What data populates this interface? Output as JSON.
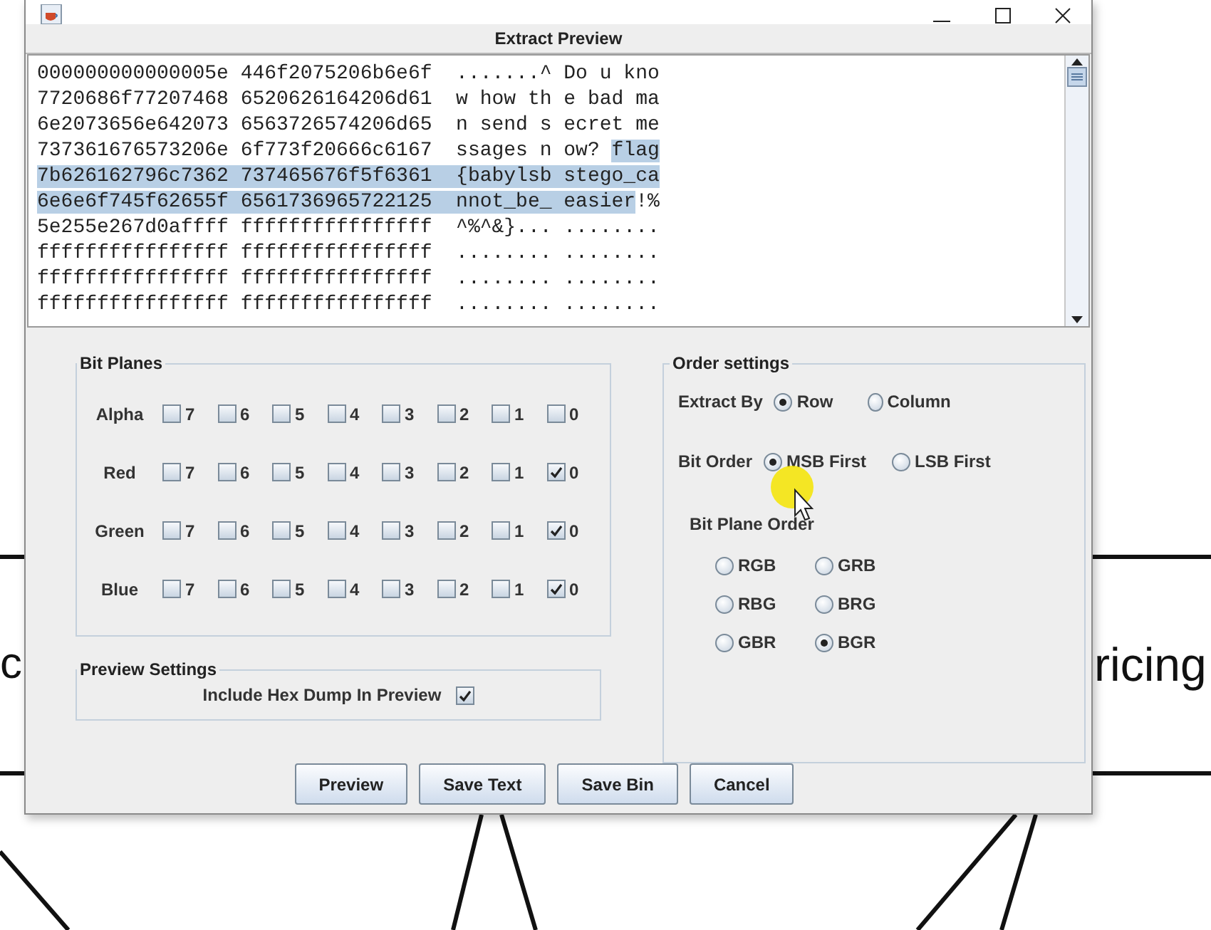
{
  "background": {
    "labels": [
      "c",
      "ricing"
    ]
  },
  "header": {
    "title": "Extract Preview"
  },
  "preview": {
    "lines": [
      {
        "segments": [
          {
            "text": "000000000000005e 446f2075206b6e6f  .......^ Do u kno",
            "selected": false
          }
        ]
      },
      {
        "segments": [
          {
            "text": "7720686f77207468 6520626164206d61  w how th e bad ma",
            "selected": false
          }
        ]
      },
      {
        "segments": [
          {
            "text": "6e2073656e642073 6563726574206d65  n send s ecret me",
            "selected": false
          }
        ]
      },
      {
        "segments": [
          {
            "text": "737361676573206e 6f773f20666c6167  ssages n ow? ",
            "selected": false
          },
          {
            "text": "flag",
            "selected": true
          }
        ]
      },
      {
        "segments": [
          {
            "text": "7b626162796c7362 737465676f5f6361  {babylsb stego_ca",
            "selected": true
          }
        ]
      },
      {
        "segments": [
          {
            "text": "6e6e6f745f62655f 6561736965722125  nnot_be_ easier",
            "selected": true
          },
          {
            "text": "!%",
            "selected": false
          }
        ]
      },
      {
        "segments": [
          {
            "text": "5e255e267d0affff ffffffffffffffff  ^%^&}... ........",
            "selected": false
          }
        ]
      },
      {
        "segments": [
          {
            "text": "ffffffffffffffff ffffffffffffffff  ........ ........",
            "selected": false
          }
        ]
      },
      {
        "segments": [
          {
            "text": "ffffffffffffffff ffffffffffffffff  ........ ........",
            "selected": false
          }
        ]
      },
      {
        "segments": [
          {
            "text": "ffffffffffffffff ffffffffffffffff  ........ ........",
            "selected": false
          }
        ]
      }
    ]
  },
  "bit_planes": {
    "title": "Bit Planes",
    "channels": [
      {
        "name": "Alpha",
        "bits": [
          {
            "label": "7",
            "checked": false
          },
          {
            "label": "6",
            "checked": false
          },
          {
            "label": "5",
            "checked": false
          },
          {
            "label": "4",
            "checked": false
          },
          {
            "label": "3",
            "checked": false
          },
          {
            "label": "2",
            "checked": false
          },
          {
            "label": "1",
            "checked": false
          },
          {
            "label": "0",
            "checked": false
          }
        ]
      },
      {
        "name": "Red",
        "bits": [
          {
            "label": "7",
            "checked": false
          },
          {
            "label": "6",
            "checked": false
          },
          {
            "label": "5",
            "checked": false
          },
          {
            "label": "4",
            "checked": false
          },
          {
            "label": "3",
            "checked": false
          },
          {
            "label": "2",
            "checked": false
          },
          {
            "label": "1",
            "checked": false
          },
          {
            "label": "0",
            "checked": true
          }
        ]
      },
      {
        "name": "Green",
        "bits": [
          {
            "label": "7",
            "checked": false
          },
          {
            "label": "6",
            "checked": false
          },
          {
            "label": "5",
            "checked": false
          },
          {
            "label": "4",
            "checked": false
          },
          {
            "label": "3",
            "checked": false
          },
          {
            "label": "2",
            "checked": false
          },
          {
            "label": "1",
            "checked": false
          },
          {
            "label": "0",
            "checked": true
          }
        ]
      },
      {
        "name": "Blue",
        "bits": [
          {
            "label": "7",
            "checked": false
          },
          {
            "label": "6",
            "checked": false
          },
          {
            "label": "5",
            "checked": false
          },
          {
            "label": "4",
            "checked": false
          },
          {
            "label": "3",
            "checked": false
          },
          {
            "label": "2",
            "checked": false
          },
          {
            "label": "1",
            "checked": false
          },
          {
            "label": "0",
            "checked": true
          }
        ]
      }
    ]
  },
  "preview_settings": {
    "title": "Preview Settings",
    "options": [
      {
        "label": "Include Hex Dump In Preview",
        "checked": true
      }
    ]
  },
  "order_settings": {
    "title": "Order settings",
    "extract_by": {
      "label": "Extract By",
      "options": [
        {
          "label": "Row",
          "selected": true
        },
        {
          "label": "Column",
          "selected": false
        }
      ]
    },
    "bit_order": {
      "label": "Bit Order",
      "options": [
        {
          "label": "MSB First",
          "selected": true
        },
        {
          "label": "LSB First",
          "selected": false
        }
      ]
    },
    "bit_plane_order": {
      "label": "Bit Plane Order",
      "options": [
        {
          "label": "RGB",
          "selected": false
        },
        {
          "label": "GRB",
          "selected": false
        },
        {
          "label": "RBG",
          "selected": false
        },
        {
          "label": "BRG",
          "selected": false
        },
        {
          "label": "GBR",
          "selected": false
        },
        {
          "label": "BGR",
          "selected": true
        }
      ]
    }
  },
  "buttons": [
    "Preview",
    "Save Text",
    "Save Bin",
    "Cancel"
  ]
}
